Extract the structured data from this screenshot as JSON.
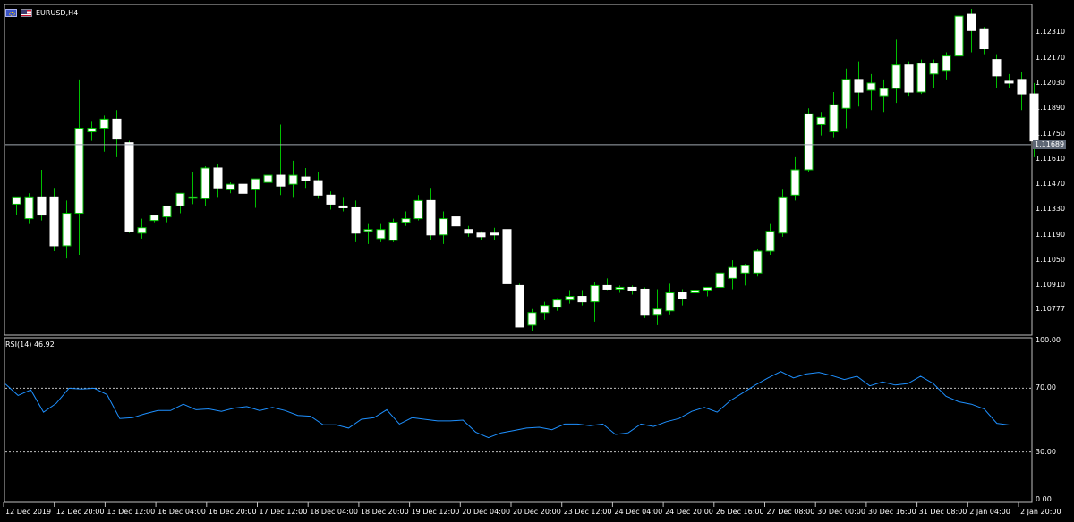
{
  "symbol_title": "EURUSD,H4",
  "rsi_label": "RSI(14) 46.92",
  "current_price": "1.11689",
  "colors": {
    "background": "#000000",
    "bull_outline": "#00c000",
    "candle_body": "#ffffff",
    "rsi_line": "#1e90ff",
    "frame": "#c0c0c0",
    "price_line": "#a0a8b0",
    "price_tag": "#5e6775"
  },
  "icons": [
    "eu-flag-icon",
    "us-flag-icon"
  ],
  "price_axis": [
    "1.12310",
    "1.12170",
    "1.12030",
    "1.11890",
    "1.11750",
    "1.11610",
    "1.11470",
    "1.11330",
    "1.11190",
    "1.11050",
    "1.10910",
    "1.10777"
  ],
  "rsi_axis": [
    "100.00",
    "70.00",
    "30.00",
    "0.00"
  ],
  "time_axis": [
    "12 Dec 2019",
    "12 Dec 20:00",
    "13 Dec 12:00",
    "16 Dec 04:00",
    "16 Dec 20:00",
    "17 Dec 12:00",
    "18 Dec 04:00",
    "18 Dec 20:00",
    "19 Dec 12:00",
    "20 Dec 04:00",
    "20 Dec 20:00",
    "23 Dec 12:00",
    "24 Dec 04:00",
    "24 Dec 20:00",
    "26 Dec 16:00",
    "27 Dec 08:00",
    "30 Dec 00:00",
    "30 Dec 16:00",
    "31 Dec 08:00",
    "2 Jan 04:00",
    "2 Jan 20:00"
  ],
  "chart_data": {
    "type": "candlestick",
    "title": "EURUSD,H4",
    "ylim": [
      1.1065,
      1.1245
    ],
    "candles": [
      [
        1.1136,
        1.114,
        1.113,
        1.114
      ],
      [
        1.1128,
        1.1142,
        1.1125,
        1.114
      ],
      [
        1.114,
        1.1155,
        1.1127,
        1.113
      ],
      [
        1.114,
        1.1145,
        1.111,
        1.1113
      ],
      [
        1.1113,
        1.1138,
        1.1106,
        1.1131
      ],
      [
        1.1131,
        1.1205,
        1.1108,
        1.1178
      ],
      [
        1.1176,
        1.1182,
        1.1171,
        1.1178
      ],
      [
        1.1178,
        1.1185,
        1.1165,
        1.1183
      ],
      [
        1.1183,
        1.1188,
        1.1162,
        1.1172
      ],
      [
        1.117,
        1.1171,
        1.112,
        1.1121
      ],
      [
        1.112,
        1.1128,
        1.1117,
        1.1123
      ],
      [
        1.1127,
        1.113,
        1.1126,
        1.113
      ],
      [
        1.1129,
        1.1135,
        1.1126,
        1.1135
      ],
      [
        1.1135,
        1.1142,
        1.1131,
        1.1142
      ],
      [
        1.114,
        1.1154,
        1.1136,
        1.114
      ],
      [
        1.1139,
        1.1157,
        1.1135,
        1.1156
      ],
      [
        1.1156,
        1.1158,
        1.114,
        1.1145
      ],
      [
        1.1144,
        1.1148,
        1.1142,
        1.1147
      ],
      [
        1.1147,
        1.116,
        1.114,
        1.1142
      ],
      [
        1.1144,
        1.115,
        1.1134,
        1.115
      ],
      [
        1.1148,
        1.1156,
        1.1144,
        1.1152
      ],
      [
        1.1152,
        1.118,
        1.1141,
        1.1146
      ],
      [
        1.1147,
        1.116,
        1.114,
        1.1152
      ],
      [
        1.1151,
        1.1156,
        1.1145,
        1.1149
      ],
      [
        1.1149,
        1.1154,
        1.1139,
        1.1141
      ],
      [
        1.1141,
        1.1143,
        1.1133,
        1.1136
      ],
      [
        1.1135,
        1.114,
        1.1132,
        1.1134
      ],
      [
        1.1134,
        1.1138,
        1.1115,
        1.112
      ],
      [
        1.1121,
        1.1125,
        1.1114,
        1.1122
      ],
      [
        1.1117,
        1.1125,
        1.1115,
        1.1122
      ],
      [
        1.1116,
        1.1128,
        1.1115,
        1.1126
      ],
      [
        1.1126,
        1.1132,
        1.1124,
        1.1128
      ],
      [
        1.1128,
        1.1141,
        1.1127,
        1.1138
      ],
      [
        1.1138,
        1.1145,
        1.1116,
        1.1119
      ],
      [
        1.1119,
        1.1132,
        1.1114,
        1.1128
      ],
      [
        1.1129,
        1.1131,
        1.1122,
        1.1124
      ],
      [
        1.1122,
        1.1124,
        1.1118,
        1.112
      ],
      [
        1.112,
        1.1121,
        1.1116,
        1.1118
      ],
      [
        1.112,
        1.1123,
        1.1116,
        1.1119
      ],
      [
        1.1122,
        1.1124,
        1.1088,
        1.1092
      ],
      [
        1.1091,
        1.1092,
        1.1068,
        1.1068
      ],
      [
        1.1069,
        1.1078,
        1.1066,
        1.1076
      ],
      [
        1.1076,
        1.1082,
        1.1072,
        1.108
      ],
      [
        1.1079,
        1.1084,
        1.1077,
        1.1083
      ],
      [
        1.1083,
        1.1088,
        1.1081,
        1.1085
      ],
      [
        1.1085,
        1.1088,
        1.108,
        1.1082
      ],
      [
        1.1082,
        1.1093,
        1.1071,
        1.1091
      ],
      [
        1.1091,
        1.1095,
        1.1088,
        1.1089
      ],
      [
        1.1089,
        1.1091,
        1.1087,
        1.109
      ],
      [
        1.109,
        1.1091,
        1.1086,
        1.1088
      ],
      [
        1.1089,
        1.109,
        1.1073,
        1.1075
      ],
      [
        1.1075,
        1.1089,
        1.1069,
        1.1078
      ],
      [
        1.1077,
        1.1092,
        1.1075,
        1.1087
      ],
      [
        1.1087,
        1.1089,
        1.108,
        1.1084
      ],
      [
        1.1087,
        1.1089,
        1.1087,
        1.1088
      ],
      [
        1.1088,
        1.109,
        1.1085,
        1.109
      ],
      [
        1.109,
        1.1099,
        1.1083,
        1.1098
      ],
      [
        1.1095,
        1.1105,
        1.1089,
        1.1101
      ],
      [
        1.1098,
        1.1103,
        1.1091,
        1.1102
      ],
      [
        1.1098,
        1.1111,
        1.1096,
        1.111
      ],
      [
        1.111,
        1.1125,
        1.1108,
        1.1121
      ],
      [
        1.112,
        1.1144,
        1.1118,
        1.114
      ],
      [
        1.1141,
        1.1162,
        1.1138,
        1.1155
      ],
      [
        1.1155,
        1.1189,
        1.1154,
        1.1186
      ],
      [
        1.118,
        1.1187,
        1.1174,
        1.1184
      ],
      [
        1.1176,
        1.1198,
        1.1173,
        1.1191
      ],
      [
        1.1189,
        1.1211,
        1.1178,
        1.1205
      ],
      [
        1.1205,
        1.1215,
        1.119,
        1.1198
      ],
      [
        1.1199,
        1.1208,
        1.1188,
        1.1203
      ],
      [
        1.1196,
        1.1205,
        1.1187,
        1.12
      ],
      [
        1.12,
        1.1227,
        1.1192,
        1.1213
      ],
      [
        1.1213,
        1.1215,
        1.1196,
        1.1198
      ],
      [
        1.1198,
        1.1216,
        1.1197,
        1.1214
      ],
      [
        1.1208,
        1.1216,
        1.12,
        1.1214
      ],
      [
        1.121,
        1.122,
        1.1205,
        1.1218
      ],
      [
        1.1218,
        1.1245,
        1.1215,
        1.124
      ],
      [
        1.1241,
        1.1244,
        1.122,
        1.1232
      ],
      [
        1.1233,
        1.1234,
        1.1219,
        1.1222
      ],
      [
        1.1216,
        1.1219,
        1.12,
        1.1207
      ],
      [
        1.1204,
        1.1208,
        1.12,
        1.1203
      ],
      [
        1.1205,
        1.1209,
        1.1188,
        1.1197
      ],
      [
        1.1197,
        1.1203,
        1.1162,
        1.1171
      ],
      [
        1.1171,
        1.1171,
        1.1167,
        1.1169
      ]
    ],
    "rsi": {
      "name": "RSI(14)",
      "levels": [
        70,
        30
      ],
      "ylim": [
        0,
        100
      ],
      "values": [
        72.7,
        65.5,
        69.0,
        55.0,
        60.5,
        70.0,
        69.5,
        70.0,
        66.0,
        51.0,
        51.5,
        54.0,
        56.0,
        56.0,
        60.0,
        56.5,
        57.0,
        55.5,
        57.5,
        58.5,
        56.0,
        58.0,
        56.0,
        53.0,
        52.5,
        47.0,
        47.0,
        45.0,
        50.5,
        51.5,
        56.5,
        47.5,
        51.5,
        50.5,
        49.5,
        49.5,
        50.0,
        42.5,
        39.0,
        42.0,
        43.5,
        45.0,
        45.5,
        44.0,
        47.5,
        47.5,
        46.5,
        47.5,
        41.0,
        42.0,
        47.5,
        46.0,
        49.0,
        51.0,
        55.5,
        58.0,
        55.0,
        62.0,
        67.0,
        72.0,
        76.5,
        80.5,
        76.5,
        79.0,
        80.0,
        78.0,
        75.5,
        77.5,
        71.5,
        74.0,
        72.0,
        73.0,
        77.5,
        73.0,
        65.0,
        61.5,
        60.0,
        57.0,
        48.0,
        46.9
      ]
    }
  }
}
